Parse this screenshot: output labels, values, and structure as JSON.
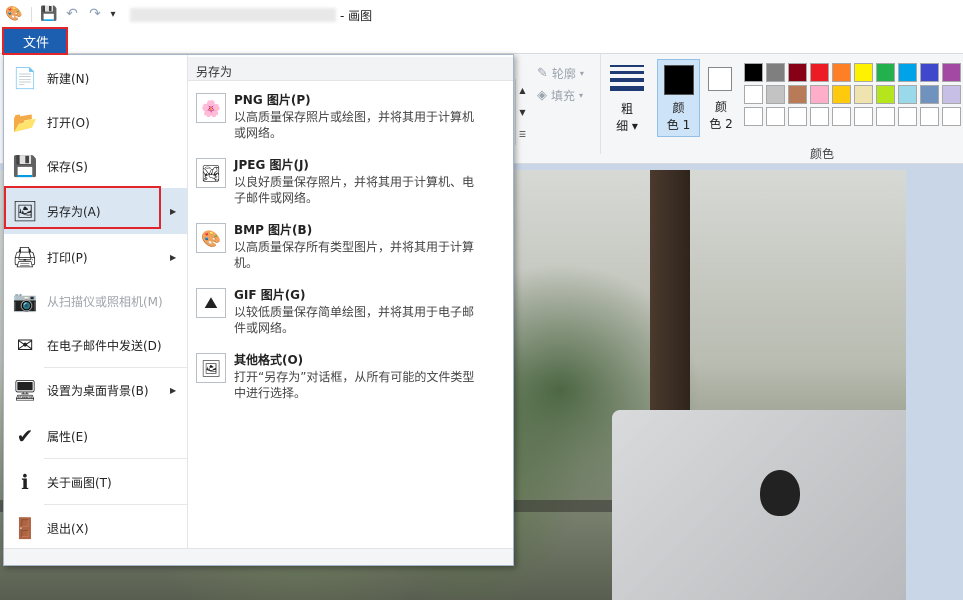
{
  "window": {
    "title_suffix": "- 画图",
    "quick_access": [
      "app-icon",
      "save-icon",
      "undo-icon",
      "redo-icon",
      "customize-icon"
    ]
  },
  "ribbon": {
    "file_tab_label": "文件",
    "shapes": {
      "outline_label": "轮廓",
      "fill_label": "填充"
    },
    "size_label_line1": "粗",
    "size_label_line2": "细",
    "color1_line1": "颜",
    "color1_line2": "色 1",
    "color2_line1": "颜",
    "color2_line2": "色 2",
    "palette_label": "颜色",
    "palette_colors": [
      "#000000",
      "#7f7f7f",
      "#880015",
      "#ed1c24",
      "#ff7f27",
      "#fff200",
      "#22b14c",
      "#00a2e8",
      "#3f48cc",
      "#a349a4",
      "#ffffff",
      "#c3c3c3",
      "#b97a57",
      "#ffaec9",
      "#ffc90e",
      "#efe4b0",
      "#b5e61d",
      "#99d9ea",
      "#7092be",
      "#c8bfe7",
      "#ffffff",
      "#ffffff",
      "#ffffff",
      "#ffffff",
      "#ffffff",
      "#ffffff",
      "#ffffff",
      "#ffffff",
      "#ffffff",
      "#ffffff"
    ]
  },
  "file_menu": {
    "items": [
      {
        "label": "新建(N)",
        "icon": "new-document-icon",
        "glyph": "📄",
        "submenu": false,
        "disabled": false
      },
      {
        "label": "打开(O)",
        "icon": "open-folder-icon",
        "glyph": "📂",
        "submenu": false,
        "disabled": false
      },
      {
        "label": "保存(S)",
        "icon": "save-icon",
        "glyph": "💾",
        "submenu": false,
        "disabled": false
      },
      {
        "label": "另存为(A)",
        "icon": "save-as-icon",
        "glyph": "🖼",
        "submenu": true,
        "disabled": false
      },
      {
        "label": "打印(P)",
        "icon": "printer-icon",
        "glyph": "🖨",
        "submenu": true,
        "disabled": false
      },
      {
        "label": "从扫描仪或照相机(M)",
        "icon": "scanner-icon",
        "glyph": "📷",
        "submenu": false,
        "disabled": true
      },
      {
        "label": "在电子邮件中发送(D)",
        "icon": "email-icon",
        "glyph": "✉",
        "submenu": false,
        "disabled": false
      },
      {
        "label": "设置为桌面背景(B)",
        "icon": "desktop-background-icon",
        "glyph": "🖥",
        "submenu": true,
        "disabled": false
      },
      {
        "label": "属性(E)",
        "icon": "checkmark-icon",
        "glyph": "✔",
        "submenu": false,
        "disabled": false
      },
      {
        "label": "关于画图(T)",
        "icon": "info-icon",
        "glyph": "ℹ",
        "submenu": false,
        "disabled": false
      },
      {
        "label": "退出(X)",
        "icon": "exit-icon",
        "glyph": "🚪",
        "submenu": false,
        "disabled": false
      }
    ]
  },
  "save_as_submenu": {
    "header": "另存为",
    "options": [
      {
        "title": "PNG 图片(P)",
        "desc": "以高质量保存照片或绘图，并将其用于计算机或网络。",
        "icon": "png-image-icon",
        "glyph": "🌸"
      },
      {
        "title": "JPEG 图片(J)",
        "desc": "以良好质量保存照片，并将其用于计算机、电子邮件或网络。",
        "icon": "jpeg-image-icon",
        "glyph": "🏞"
      },
      {
        "title": "BMP 图片(B)",
        "desc": "以高质量保存所有类型图片，并将其用于计算机。",
        "icon": "bmp-image-icon",
        "glyph": "🎨"
      },
      {
        "title": "GIF 图片(G)",
        "desc": "以较低质量保存简单绘图，并将其用于电子邮件或网络。",
        "icon": "gif-image-icon",
        "glyph": "⛰"
      },
      {
        "title": "其他格式(O)",
        "desc": "打开“另存为”对话框，从所有可能的文件类型中进行选择。",
        "icon": "other-formats-icon",
        "glyph": "🖼"
      }
    ]
  }
}
